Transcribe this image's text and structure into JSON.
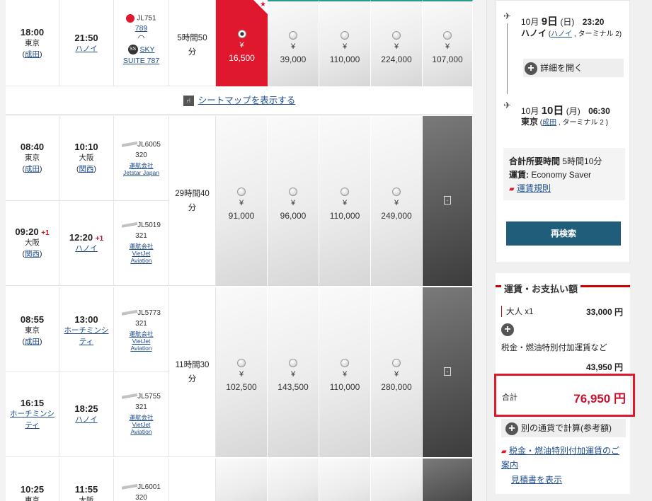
{
  "row1": {
    "dep_time": "18:00",
    "dep_city": "東京",
    "dep_airport": "成田",
    "arr_time": "21:50",
    "arr_city": "ハノイ",
    "flight": "JL751",
    "flight_sub": "789",
    "sky_label": "SKY",
    "sky_suite": "SUITE 787",
    "duration": "5時間50分",
    "yen": "¥",
    "prices": [
      "16,500",
      "39,000",
      "110,000",
      "224,000",
      "107,000"
    ],
    "wifi_icon": "wifi-icon",
    "selected_color": "#e0182d"
  },
  "seatmap_link": "シートマップを表示する",
  "row2": {
    "duration": "29時間40分",
    "prices": [
      "91,000",
      "96,000",
      "110,000",
      "249,000"
    ],
    "minus": "-",
    "leg1": {
      "dep_time": "08:40",
      "dep_city": "東京",
      "dep_airport": "成田",
      "arr_time": "10:10",
      "arr_city": "大阪",
      "arr_airport": "関西",
      "flight": "JL6005",
      "aircraft": "320",
      "op1": "運航会社",
      "op2": "Jetstar Japan"
    },
    "leg2": {
      "dep_time": "09:20",
      "dep_plus": "+1",
      "dep_city": "大阪",
      "dep_airport": "関西",
      "arr_time": "12:20",
      "arr_plus": "+1",
      "arr_city": "ハノイ",
      "flight": "JL5019",
      "aircraft": "321",
      "op1": "運航会社",
      "op2": "VietJet",
      "op3": "Aviation"
    }
  },
  "row3": {
    "duration": "11時間30分",
    "prices": [
      "102,500",
      "143,500",
      "110,000",
      "280,000"
    ],
    "minus": "-",
    "leg1": {
      "dep_time": "08:55",
      "dep_city": "東京",
      "dep_airport": "成田",
      "arr_time": "13:00",
      "arr_city": "ホーチミンシティ",
      "flight": "JL5773",
      "aircraft": "321",
      "op1": "運航会社",
      "op2": "VietJet",
      "op3": "Aviation"
    },
    "leg2": {
      "dep_time": "16:15",
      "dep_city": "ホーチミンシティ",
      "arr_time": "18:25",
      "arr_city": "ハノイ",
      "flight": "JL5755",
      "aircraft": "321",
      "op1": "運航会社",
      "op2": "VietJet",
      "op3": "Aviation"
    }
  },
  "row4": {
    "dep_time": "10:25",
    "dep_city": "東京",
    "arr_time": "11:55",
    "arr_city": "大阪",
    "flight": "JL6001",
    "aircraft": "320"
  },
  "summary": {
    "dep_month": "10月",
    "dep_day": "9日",
    "dep_dow": "(日)",
    "dep_time": "23:20",
    "dep_city": "ハノイ",
    "dep_airport": "ハノイ",
    "dep_terminal": ", ターミナル 2)",
    "details_btn": "詳細を開く",
    "arr_month": "10月",
    "arr_day": "10日",
    "arr_dow": "(月)",
    "arr_time": "06:30",
    "arr_city": "東京",
    "arr_airport": "成田",
    "arr_terminal": ", ターミナル 2 )",
    "total_time_label": "合計所要時間",
    "total_time": "5時間10分",
    "fare_label": "運賃:",
    "fare_value": "Economy Saver",
    "fare_rules": "運賃規則",
    "research_btn": "再検索"
  },
  "payment": {
    "title": "運賃・お支払い額",
    "adult": "大人 x1",
    "adult_amount": "33,000 円",
    "taxes_label": "税金・燃油特別付加運賃など",
    "taxes_amount": "43,950 円",
    "total_label": "合計",
    "total_amount": "76,950 円",
    "currency_btn": "別の通貨で計算(参考額)",
    "taxes_link": "税金・燃油特別付加運賃のご案内",
    "estimate_link": "見積書を表示"
  },
  "colors": {
    "red": "#e0182d",
    "teal": "#1f5d7a",
    "link": "#1f4e8c"
  }
}
